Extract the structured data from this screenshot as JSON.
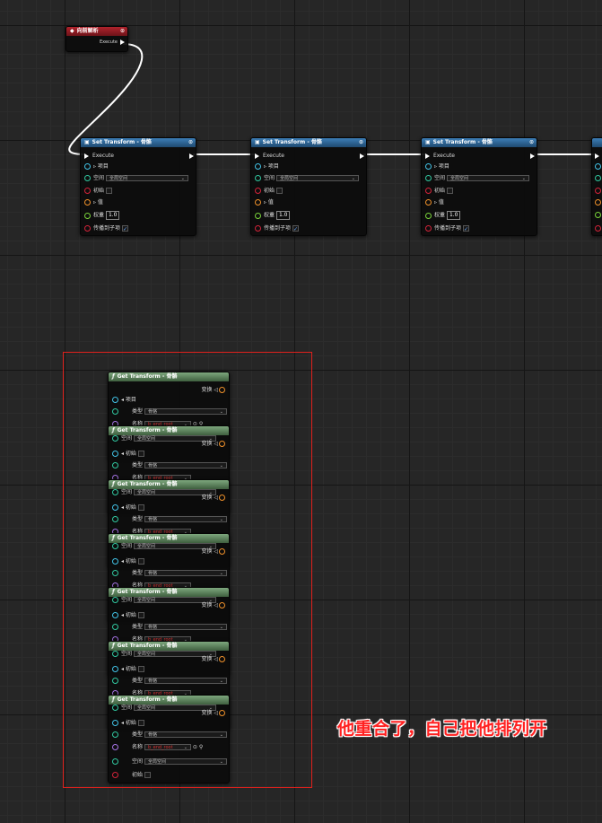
{
  "event_node": {
    "title": "向前解析",
    "exec_out_label": "Execute"
  },
  "set_nodes": [
    {
      "title": "Set Transform - 骨骼",
      "exec_label": "Execute",
      "item_label": "项目",
      "space_label": "空间",
      "space_value": "全局空间",
      "initial_label": "初始",
      "value_label": "值",
      "weight_label": "权重",
      "weight_value": "1.0",
      "propagate_label": "传播到子项"
    },
    {
      "title": "Set Transform - 骨骼",
      "exec_label": "Execute",
      "item_label": "项目",
      "space_label": "空间",
      "space_value": "全局空间",
      "initial_label": "初始",
      "value_label": "值",
      "weight_label": "权重",
      "weight_value": "1.0",
      "propagate_label": "传播到子项"
    },
    {
      "title": "Set Transform - 骨骼",
      "exec_label": "Execute",
      "item_label": "项目",
      "space_label": "空间",
      "space_value": "全局空间",
      "initial_label": "初始",
      "value_label": "值",
      "weight_label": "权重",
      "weight_value": "1.0",
      "propagate_label": "传播到子项"
    }
  ],
  "get_node": {
    "title": "Get Transform - 骨骼",
    "transform_label": "变换",
    "item_label": "项目",
    "type_label": "类型",
    "type_value": "骨骼",
    "name_label": "名称",
    "name_value": "b_end_root",
    "space_label": "空间",
    "space_value": "全局空间",
    "initial_label": "初始"
  },
  "annotation": "他重合了，自己把他排列开",
  "colors": {
    "exec_wire": "#ffffff",
    "selection": "#e0201c",
    "annotation": "#ff2222"
  }
}
